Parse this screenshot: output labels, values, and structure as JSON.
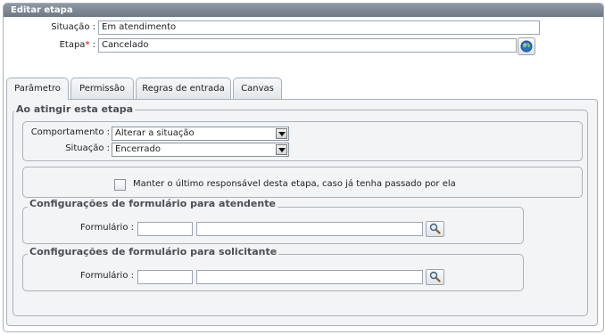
{
  "window": {
    "title": "Editar etapa"
  },
  "top_form": {
    "situacao_label": "Situação :",
    "situacao_value": "Em atendimento",
    "etapa_label": "Etapa",
    "etapa_required": "*",
    "etapa_suffix": " :",
    "etapa_value": "Cancelado",
    "globe_icon": "globe-icon"
  },
  "tabs": [
    {
      "label": "Parâmetro",
      "active": true
    },
    {
      "label": "Permissão",
      "active": false
    },
    {
      "label": "Regras de entrada",
      "active": false
    },
    {
      "label": "Canvas",
      "active": false
    }
  ],
  "main": {
    "group_title": "Ao atingir esta etapa",
    "comportamento_label": "Comportamento :",
    "comportamento_value": "Alterar a situação",
    "situacao_label": "Situação :",
    "situacao_value": "Encerrado",
    "manter_label": "Manter o último responsável desta etapa, caso já tenha passado por ela",
    "manter_checked": false,
    "atendente": {
      "title": "Configurações de formulário para atendente",
      "formulario_label": "Formulário :",
      "code_value": "",
      "name_value": ""
    },
    "solicitante": {
      "title": "Configurações de formulário para solicitante",
      "formulario_label": "Formulário :",
      "code_value": "",
      "name_value": ""
    },
    "search_icon": "search-icon"
  },
  "colors": {
    "header": "#7d8894",
    "accent_blue": "#2f6fc4",
    "required": "#d40000"
  }
}
